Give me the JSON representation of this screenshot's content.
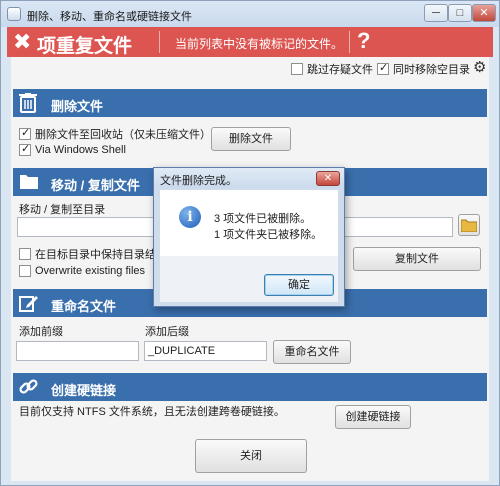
{
  "window": {
    "title": "删除、移动、重命名或硬链接文件",
    "minimize_label": "─",
    "maximize_label": "□",
    "close_label": "✕"
  },
  "banner": {
    "title": "项重复文件",
    "message": "当前列表中没有被标记的文件。",
    "help_label": "?"
  },
  "options": {
    "skip_suspect_label": "跳过存疑文件",
    "skip_suspect_checked": false,
    "remove_empty_dirs_label": "同时移除空目录",
    "remove_empty_dirs_checked": true
  },
  "delete_section": {
    "title": "删除文件",
    "recycle_label": "删除文件至回收站（仅未压缩文件）",
    "recycle_checked": true,
    "shell_label": "Via Windows Shell",
    "shell_checked": true,
    "button_label": "删除文件"
  },
  "move_section": {
    "title": "移动 / 复制文件",
    "target_label": "移动 / 复制至目录",
    "target_value": "",
    "keep_structure_label": "在目标目录中保持目录结构",
    "keep_structure_checked": false,
    "overwrite_label": "Overwrite existing files",
    "overwrite_checked": false,
    "copy_button_label": "复制文件"
  },
  "rename_section": {
    "title": "重命名文件",
    "prefix_label": "添加前缀",
    "prefix_value": "",
    "suffix_label": "添加后缀",
    "suffix_value": "_DUPLICATE",
    "button_label": "重命名文件"
  },
  "hardlink_section": {
    "title": "创建硬链接",
    "note": "目前仅支持 NTFS 文件系统，且无法创建跨卷硬链接。",
    "button_label": "创建硬链接"
  },
  "close_button_label": "关闭",
  "dialog": {
    "title": "文件删除完成。",
    "close_label": "✕",
    "line1": "3 项文件已被删除。",
    "line2": "1 项文件夹已被移除。",
    "ok_label": "确定"
  },
  "icons": {
    "app": "app-icon",
    "banner": "x-mark-icon",
    "help": "question-icon",
    "settings": "gear-icon",
    "delete": "trash-icon",
    "move": "folder-icon",
    "rename": "pencil-icon",
    "hardlink": "link-icon",
    "info": "info-icon"
  },
  "colors": {
    "banner_red": "#dd5551",
    "section_blue": "#3a6fad",
    "window_bg": "#dbe6f3",
    "panel_bg": "#f4f4f4"
  }
}
